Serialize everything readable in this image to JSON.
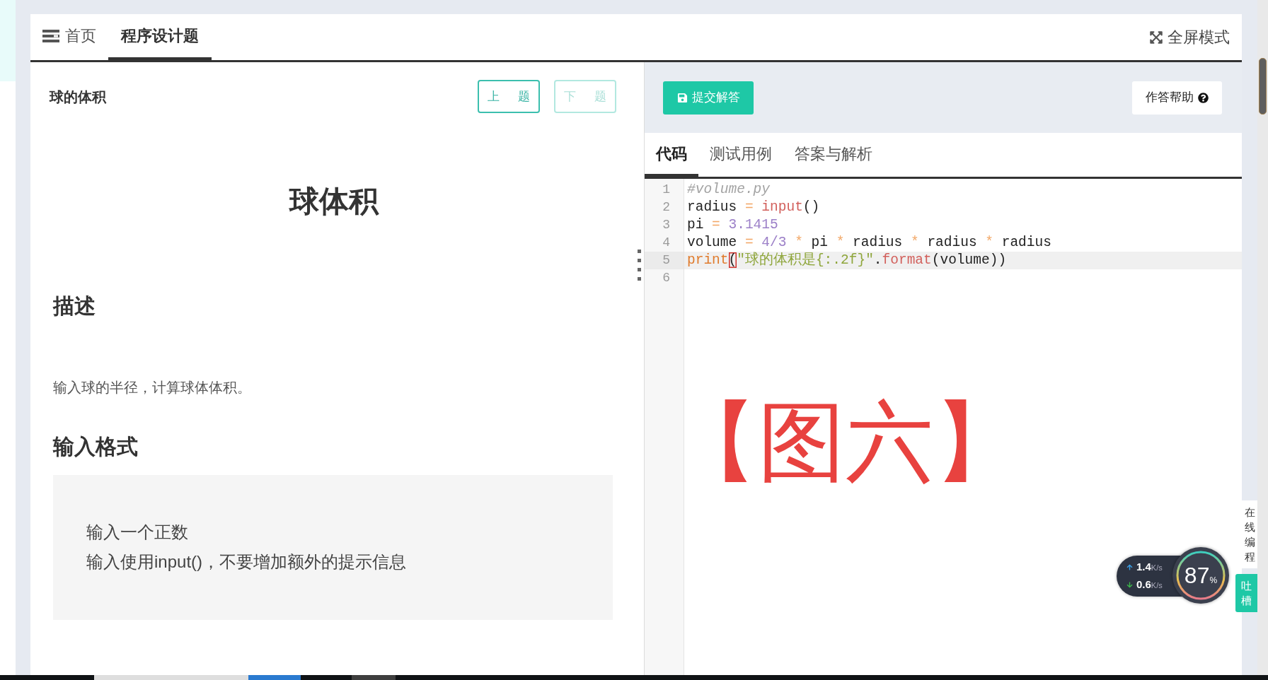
{
  "tabs": [
    {
      "label": "首页",
      "selected": false
    },
    {
      "label": "程序设计题",
      "selected": true
    }
  ],
  "fullscreen": {
    "label": "全屏模式"
  },
  "problem": {
    "title": "球的体积",
    "nav_buttons": [
      {
        "label": "上 题",
        "disabled": false
      },
      {
        "label": "下 题",
        "disabled": true
      }
    ],
    "heading": "球体积",
    "sections": [
      {
        "heading": "描述",
        "kind": "text",
        "body": [
          "输入球的半径，计算球体体积。"
        ]
      },
      {
        "heading": "输入格式",
        "kind": "block",
        "body": [
          "输入一个正数",
          "输入使用input()，不要增加额外的提示信息"
        ]
      }
    ]
  },
  "toolbar": {
    "submit": "提交解答",
    "help": "作答帮助"
  },
  "editor_tabs": [
    {
      "label": "代码",
      "selected": true
    },
    {
      "label": "测试用例",
      "selected": false
    },
    {
      "label": "答案与解析",
      "selected": false
    }
  ],
  "editor": {
    "lines": [
      {
        "number": "1",
        "current": false,
        "tokens": [
          {
            "text": "#volume.py",
            "kind": "comment"
          }
        ]
      },
      {
        "number": "2",
        "current": false,
        "tokens": [
          {
            "text": "radius ",
            "kind": "plain"
          },
          {
            "text": "=",
            "kind": "operator"
          },
          {
            "text": " input",
            "kind": "builtin"
          },
          {
            "text": "()",
            "kind": "plain"
          }
        ]
      },
      {
        "number": "3",
        "current": false,
        "tokens": [
          {
            "text": "pi ",
            "kind": "plain"
          },
          {
            "text": "=",
            "kind": "operator"
          },
          {
            "text": " 3.1415",
            "kind": "number"
          }
        ]
      },
      {
        "number": "4",
        "current": false,
        "tokens": [
          {
            "text": "volume ",
            "kind": "plain"
          },
          {
            "text": "=",
            "kind": "operator"
          },
          {
            "text": " 4/3",
            "kind": "number"
          },
          {
            "text": " *",
            "kind": "operator"
          },
          {
            "text": " pi ",
            "kind": "plain"
          },
          {
            "text": "*",
            "kind": "operator"
          },
          {
            "text": " radius ",
            "kind": "plain"
          },
          {
            "text": "*",
            "kind": "operator"
          },
          {
            "text": " radius ",
            "kind": "plain"
          },
          {
            "text": "*",
            "kind": "operator"
          },
          {
            "text": " radius",
            "kind": "plain"
          }
        ]
      },
      {
        "number": "5",
        "current": true,
        "tokens": [
          {
            "text": "print",
            "kind": "keyword"
          },
          {
            "text": "(",
            "kind": "matched_bracket"
          },
          {
            "text": "\"球的体积是{:.2f}\"",
            "kind": "string"
          },
          {
            "text": ".format",
            "kind": "method"
          },
          {
            "text": "(volume))",
            "kind": "plain"
          }
        ]
      },
      {
        "number": "6",
        "current": false
      }
    ]
  },
  "figure_label": "【图六】",
  "net_widget": {
    "upload": {
      "value": "1.4",
      "unit": "K/s"
    },
    "download": {
      "value": "0.6",
      "unit": "K/s"
    },
    "percent": "87",
    "percent_sign": "%"
  },
  "side_tabs": [
    {
      "label": "在线编程",
      "kind": "plain"
    },
    {
      "label": "吐槽",
      "kind": "accent"
    }
  ]
}
